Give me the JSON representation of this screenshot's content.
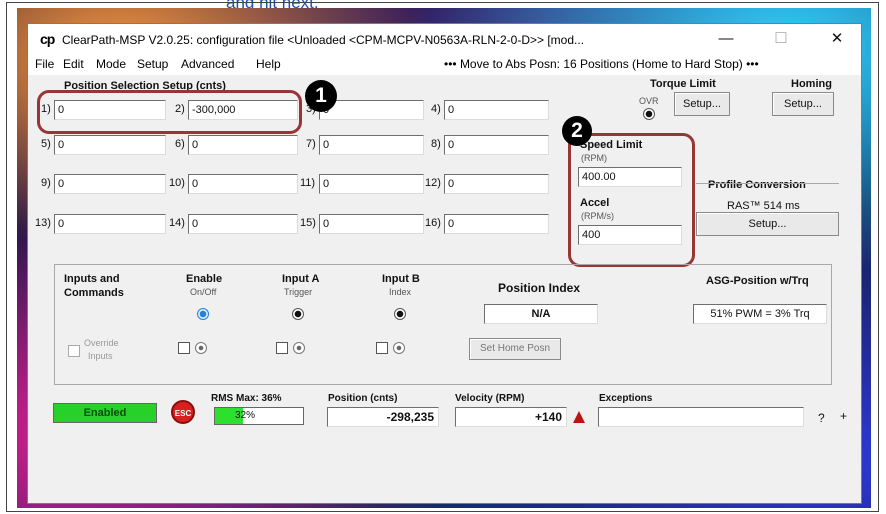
{
  "caption": "and hit next.",
  "window": {
    "logo": "cp",
    "title": "ClearPath-MSP V2.0.25:  configuration file <Unloaded <CPM-MCPV-N0563A-RLN-2-0-D>> [mod...",
    "minimize": "—",
    "maximize": "☐",
    "close": "✕"
  },
  "menu": {
    "items": [
      "File",
      "Edit",
      "Mode",
      "Setup",
      "Advanced",
      "Help"
    ],
    "status": "••• Move to Abs Posn: 16 Positions (Home to Hard Stop) •••"
  },
  "position_setup": {
    "heading": "Position Selection Setup (cnts)",
    "fields": [
      {
        "label": "1)",
        "value": "0"
      },
      {
        "label": "2)",
        "value": "-300,000"
      },
      {
        "label": "3)",
        "value": "0"
      },
      {
        "label": "4)",
        "value": "0"
      },
      {
        "label": "5)",
        "value": "0"
      },
      {
        "label": "6)",
        "value": "0"
      },
      {
        "label": "7)",
        "value": "0"
      },
      {
        "label": "8)",
        "value": "0"
      },
      {
        "label": "9)",
        "value": "0"
      },
      {
        "label": "10)",
        "value": "0"
      },
      {
        "label": "11)",
        "value": "0"
      },
      {
        "label": "12)",
        "value": "0"
      },
      {
        "label": "13)",
        "value": "0"
      },
      {
        "label": "14)",
        "value": "0"
      },
      {
        "label": "15)",
        "value": "0"
      },
      {
        "label": "16)",
        "value": "0"
      }
    ]
  },
  "torque": {
    "heading": "Torque Limit",
    "ovr": "OVR",
    "setup": "Setup..."
  },
  "homing": {
    "heading": "Homing",
    "setup": "Setup..."
  },
  "speed": {
    "limit_label": "Speed Limit",
    "limit_unit": "(RPM)",
    "limit_value": "400.00",
    "accel_label": "Accel",
    "accel_unit": "(RPM/s)",
    "accel_value": "400"
  },
  "profile": {
    "heading": "Profile Conversion",
    "value": "RAS™ 514 ms",
    "setup": "Setup..."
  },
  "badges": {
    "one": "1",
    "two": "2"
  },
  "inputs": {
    "heading_line1": "Inputs and",
    "heading_line2": "Commands",
    "enable": "Enable",
    "enable_sub": "On/Off",
    "input_a": "Input A",
    "input_a_sub": "Trigger",
    "input_b": "Input B",
    "input_b_sub": "Index",
    "override_line1": "Override",
    "override_line2": "Inputs",
    "position_index_heading": "Position Index",
    "position_index_value": "N/A",
    "set_home": "Set Home Posn",
    "asg_heading": "ASG-Position w/Trq",
    "asg_value": "51% PWM = 3% Trq"
  },
  "status": {
    "enabled": "Enabled",
    "esc": "ESC",
    "rms_label": "RMS Max: 36%",
    "rms_value": "32%",
    "rms_fraction": 0.32,
    "position_label": "Position (cnts)",
    "position_value": "-298,235",
    "velocity_label": "Velocity (RPM)",
    "velocity_value": "+140",
    "exceptions_label": "Exceptions",
    "exceptions_value": "",
    "help": "?",
    "expand": "+"
  }
}
